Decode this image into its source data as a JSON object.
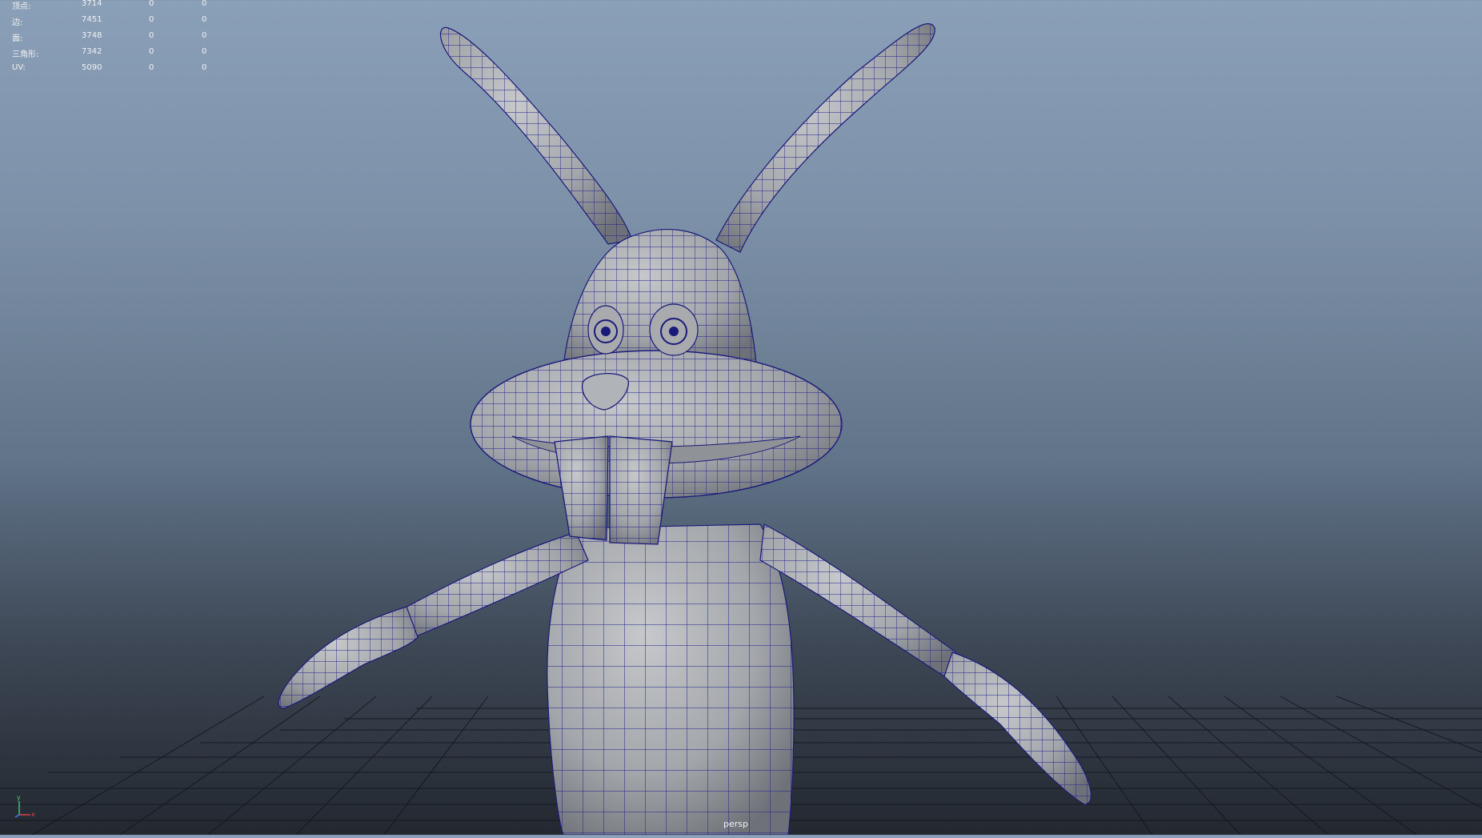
{
  "hud": {
    "rows": [
      {
        "label": "顶点:",
        "value": "3714",
        "selected": "0",
        "tris": "0"
      },
      {
        "label": "边:",
        "value": "7451",
        "selected": "0",
        "tris": "0"
      },
      {
        "label": "面:",
        "value": "3748",
        "selected": "0",
        "tris": "0"
      },
      {
        "label": "三角形:",
        "value": "7342",
        "selected": "0",
        "tris": "0"
      },
      {
        "label": "UV:",
        "value": "5090",
        "selected": "0",
        "tris": "0"
      }
    ]
  },
  "viewport": {
    "camera": "persp",
    "model": "rabbit-character-wireframe",
    "wire_color": "#1a1a8c",
    "surface_color": "#a4a6a9"
  },
  "axis": {
    "y": "y",
    "x": "x"
  }
}
